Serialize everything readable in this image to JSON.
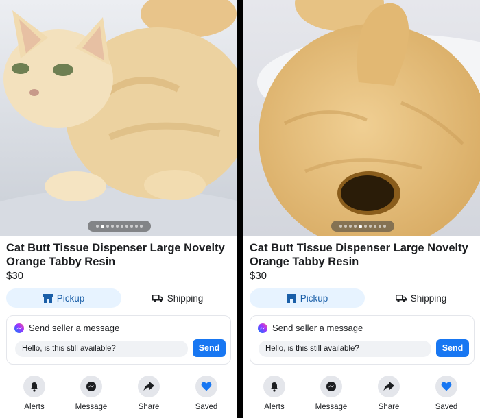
{
  "listings": [
    {
      "title": "Cat Butt Tissue Dispenser Large Novelty Orange Tabby Resin",
      "price": "$30",
      "photo_index": 2,
      "photo_count": 10,
      "tabs": {
        "pickup": "Pickup",
        "shipping": "Shipping"
      },
      "message": {
        "header": "Send seller a message",
        "input_value": "Hello, is this still available?",
        "send": "Send"
      },
      "actions": {
        "alerts": "Alerts",
        "message": "Message",
        "share": "Share",
        "saved": "Saved"
      }
    },
    {
      "title": "Cat Butt Tissue Dispenser Large Novelty Orange Tabby Resin",
      "price": "$30",
      "photo_index": 5,
      "photo_count": 10,
      "tabs": {
        "pickup": "Pickup",
        "shipping": "Shipping"
      },
      "message": {
        "header": "Send seller a message",
        "input_value": "Hello, is this still available?",
        "send": "Send"
      },
      "actions": {
        "alerts": "Alerts",
        "message": "Message",
        "share": "Share",
        "saved": "Saved"
      }
    }
  ],
  "colors": {
    "accent": "#1877f2",
    "tab_selected_bg": "#e7f3ff",
    "cat_fur": "#e9c68c"
  }
}
